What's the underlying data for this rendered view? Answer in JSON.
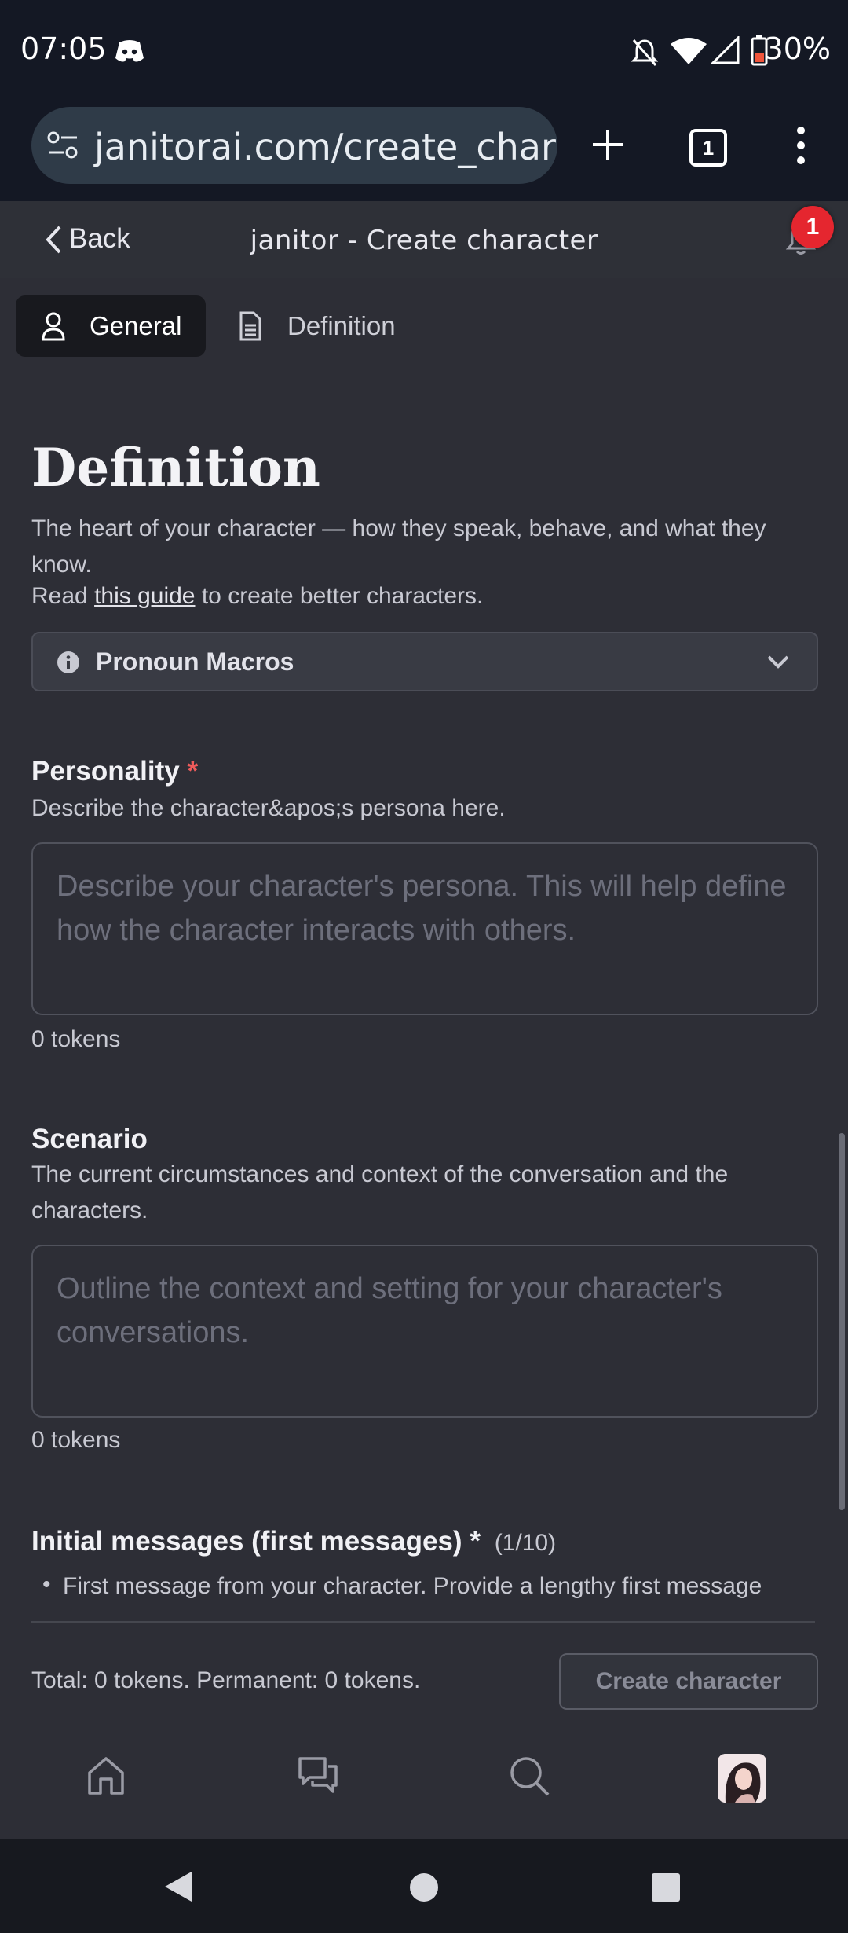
{
  "status_bar": {
    "time": "07:05",
    "battery": "30%",
    "icons": [
      "discord-icon",
      "mute-icon",
      "wifi-icon",
      "signal-icon",
      "battery-icon"
    ]
  },
  "browser": {
    "url": "janitorai.com/create_chara",
    "tab_count": "1"
  },
  "header": {
    "back_label": "Back",
    "title": "janitor - Create character",
    "notification_count": "1"
  },
  "tabs": [
    {
      "label": "General",
      "icon": "user-icon",
      "active": true
    },
    {
      "label": "Definition",
      "icon": "document-icon",
      "active": false
    }
  ],
  "definition": {
    "heading": "Definition",
    "description": "The heart of your character — how they speak, behave, and what they know.",
    "guide_prefix": "Read ",
    "guide_link": "this guide",
    "guide_suffix": " to create better characters.",
    "macros_label": "Pronoun Macros"
  },
  "personality": {
    "title": "Personality",
    "required_mark": "*",
    "description": "Describe the character&apos;s persona here.",
    "placeholder": "Describe your character's persona. This will help define how the character interacts with others.",
    "tokens": "0 tokens"
  },
  "scenario": {
    "title": "Scenario",
    "description": "The current circumstances and context of the conversation and the characters.",
    "placeholder": "Outline the context and setting for your character's conversations.",
    "tokens": "0 tokens"
  },
  "initial_messages": {
    "title": "Initial messages (first messages)",
    "required_mark": "*",
    "count": "(1/10)",
    "bullet": "First message from your character. Provide a lengthy first message"
  },
  "footer": {
    "total": "Total: 0 tokens. Permanent: 0 tokens.",
    "create_button": "Create character"
  },
  "colors": {
    "background": "#2d2e36",
    "status_bar": "#141824",
    "badge": "#e5262f",
    "required": "#ef5b5b"
  }
}
